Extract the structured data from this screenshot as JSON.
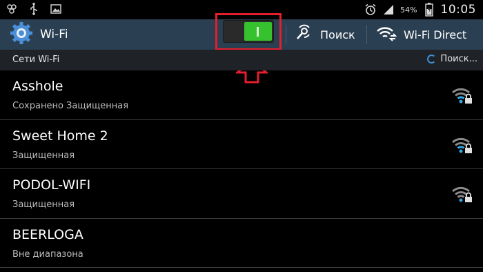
{
  "statusbar": {
    "icons": [
      "usb-settings-icon",
      "usb-icon",
      "gallery-icon"
    ],
    "right_icons": [
      "alarm-icon",
      "signal-icon"
    ],
    "battery_percent": "54%",
    "time": "10:05"
  },
  "actionbar": {
    "title": "Wi-Fi",
    "toggle_state": "on",
    "search_label": "Поиск",
    "wifi_direct_label": "Wi-Fi Direct"
  },
  "section": {
    "title": "Сети Wi-Fi",
    "searching": "Поиск..."
  },
  "networks": [
    {
      "name": "Asshole",
      "status": "Сохранено Защищенная",
      "secured": true
    },
    {
      "name": "Sweet Home 2",
      "status": "Защищенная",
      "secured": true
    },
    {
      "name": "PODOL-WIFI",
      "status": "Защищенная",
      "secured": true
    },
    {
      "name": "BEERLOGA",
      "status": "Вне диапазона",
      "secured": false
    }
  ],
  "colors": {
    "actionbar": "#2b3f52",
    "toggle_on": "#36c12f",
    "highlight": "#e41e2d",
    "wifi_blue": "#33a9e6"
  }
}
